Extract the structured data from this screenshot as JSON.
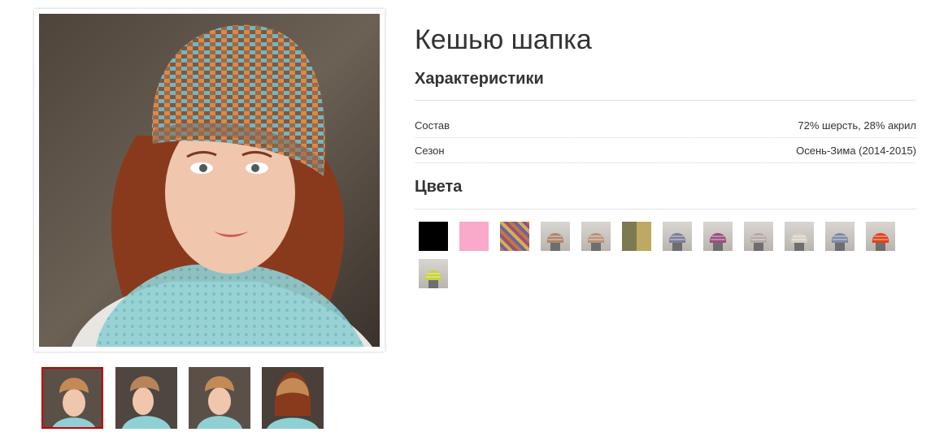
{
  "product": {
    "title": "Кешью шапка"
  },
  "characteristics": {
    "heading": "Характеристики",
    "rows": [
      {
        "label": "Состав",
        "value": "72% шерсть, 28% акрил"
      },
      {
        "label": "Сезон",
        "value": "Осень-Зима (2014-2015)"
      }
    ]
  },
  "colors": {
    "heading": "Цвета",
    "swatches": [
      {
        "name": "black",
        "color": "#000000"
      },
      {
        "name": "pink",
        "color": "#f9a9c9"
      },
      {
        "name": "multicolor-knit",
        "color": "#8e6f8c"
      },
      {
        "name": "orange-mix",
        "color": "#b0856a"
      },
      {
        "name": "orange-grey-mix",
        "color": "#b89378"
      },
      {
        "name": "olive-khaki",
        "color": "#8a8456"
      },
      {
        "name": "blue-grey-mix",
        "color": "#7d7f98"
      },
      {
        "name": "magenta-mix",
        "color": "#9a4f7f"
      },
      {
        "name": "beige-grey-mix",
        "color": "#b5aaa4"
      },
      {
        "name": "cream-mix",
        "color": "#d8cfc2"
      },
      {
        "name": "denim-mix",
        "color": "#7f89a6"
      },
      {
        "name": "red-orange",
        "color": "#e0421c"
      },
      {
        "name": "yellow-green",
        "color": "#c8d23e"
      }
    ]
  },
  "gallery": {
    "thumbnails": [
      {
        "name": "front-view",
        "active": true
      },
      {
        "name": "side-view",
        "active": false
      },
      {
        "name": "front-view-2",
        "active": false
      },
      {
        "name": "back-view",
        "active": false
      }
    ]
  }
}
